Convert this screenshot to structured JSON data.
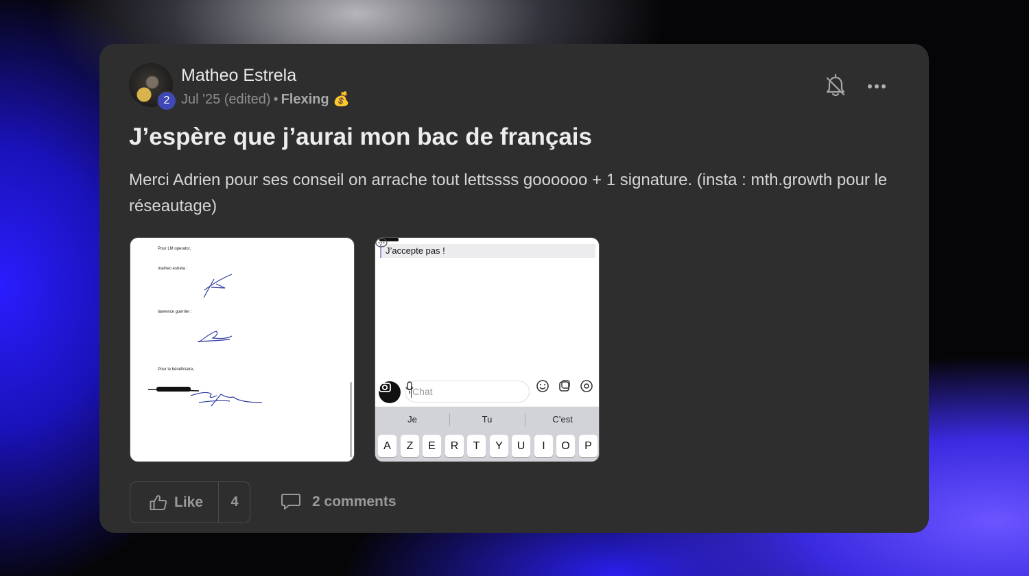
{
  "post": {
    "author": "Matheo Estrela",
    "level": "2",
    "date": "Jul '25 (edited)",
    "separator": "•",
    "category": "Flexing 💰",
    "title": "J’espère que j’aurai mon bac de français",
    "body": "Merci Adrien pour ses conseil on arrache tout lettssss goooooo + 1 signature. (insta : mth.growth pour le réseautage)"
  },
  "attachments": {
    "signature_doc": {
      "line1": "Pour LM operator,",
      "line2": "matheo estrela :",
      "line3": "lawrence guerrier :",
      "line4": "Pour le bénéficiaire,"
    },
    "chat_screenshot": {
      "message": "J’accepte pas !",
      "input_placeholder": "Chat",
      "suggestions": [
        "Je",
        "Tu",
        "C’est"
      ],
      "keys": [
        "A",
        "Z",
        "E",
        "R",
        "T",
        "Y",
        "U",
        "I",
        "O",
        "P"
      ]
    }
  },
  "actions": {
    "like_label": "Like",
    "like_count": "4",
    "comments_label": "2 comments"
  },
  "icons": {
    "notification": "bell-off-icon",
    "more": "more-horizontal-icon",
    "like": "thumbs-up-icon",
    "comment": "comment-icon"
  },
  "colors": {
    "card_bg": "#2e2e2e",
    "level_badge": "#3f49b6",
    "muted_text": "#9a9a9a"
  }
}
